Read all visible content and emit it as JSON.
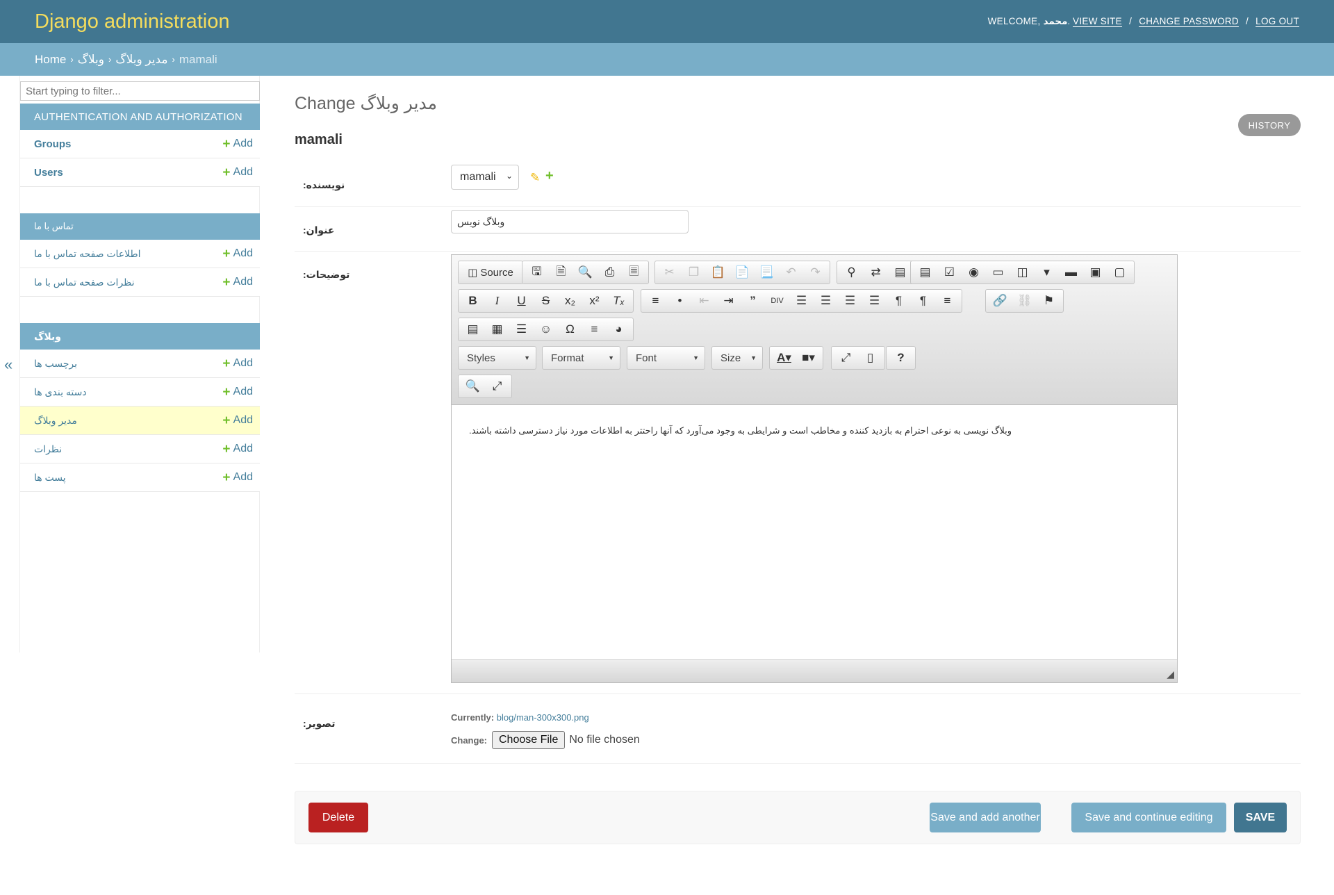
{
  "header": {
    "site_name": "Django administration",
    "welcome": "WELCOME,",
    "username": "محمد",
    "view_site": "VIEW SITE",
    "change_password": "CHANGE PASSWORD",
    "log_out": "LOG OUT",
    "sep": "/"
  },
  "breadcrumbs": {
    "home": "Home",
    "app": "وبلاگ",
    "model": "مدیر وبلاگ",
    "current": "mamali",
    "arrow": "›"
  },
  "sidebar": {
    "filter_placeholder": "Start typing to filter...",
    "toggle": "«",
    "add_label": "Add",
    "apps": [
      {
        "caption": "AUTHENTICATION AND AUTHORIZATION",
        "models": [
          "Groups",
          "Users"
        ]
      },
      {
        "caption": "تماس با ما",
        "models": [
          "اطلاعات صفحه تماس با ما",
          "نظرات صفحه تماس با ما"
        ]
      },
      {
        "caption": "وبلاگ",
        "models": [
          "برچسب ها",
          "دسته بندی ها",
          "مدیر وبلاگ",
          "نظرات",
          "پست ها"
        ]
      }
    ],
    "current_model": "مدیر وبلاگ"
  },
  "content": {
    "heading": "Change مدیر وبلاگ",
    "object_name": "mamali",
    "history_button": "HISTORY"
  },
  "form": {
    "author": {
      "label": "نویسنده:",
      "value": "mamali"
    },
    "title": {
      "label": "عنوان:",
      "value": "وبلاگ نویس"
    },
    "description": {
      "label": "توضیحات:",
      "text": "وبلاگ نویسی به نوعی احترام به بازدید کننده و مخاطب است و شرایطی به وجود می‌آورد که آنها راحتتر به اطلاعات مورد نیاز دسترسی داشته باشند."
    },
    "image": {
      "label": "تصویر:",
      "currently_label": "Currently:",
      "currently_value": "blog/man-300x300.png",
      "change_label": "Change:",
      "choose_file": "Choose File",
      "no_file": "No file chosen"
    }
  },
  "editor": {
    "source_label": "Source",
    "combos": {
      "styles": "Styles",
      "format": "Format",
      "font": "Font",
      "size": "Size"
    },
    "help": "?"
  },
  "submit": {
    "delete": "Delete",
    "save_add_another": "Save and add another",
    "save_continue": "Save and continue editing",
    "save": "SAVE"
  },
  "colors": {
    "header_bg": "#417690",
    "site_name": "#f5dd5d",
    "breadcrumbs_bg": "#79aec8",
    "link": "#447e9b",
    "add_plus": "#70bf2b",
    "delete": "#ba2121",
    "current_row": "#ffffcc"
  }
}
